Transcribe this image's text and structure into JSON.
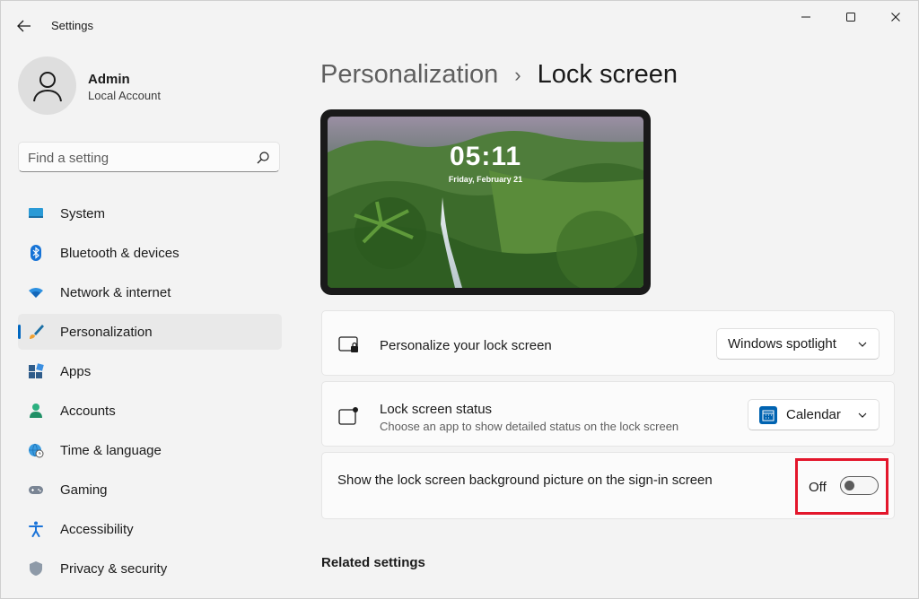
{
  "window": {
    "title": "Settings"
  },
  "user": {
    "name": "Admin",
    "account_type": "Local Account"
  },
  "search": {
    "placeholder": "Find a setting"
  },
  "sidebar": {
    "items": [
      {
        "label": "System",
        "icon": "system-icon",
        "active": false
      },
      {
        "label": "Bluetooth & devices",
        "icon": "bluetooth-icon",
        "active": false
      },
      {
        "label": "Network & internet",
        "icon": "wifi-icon",
        "active": false
      },
      {
        "label": "Personalization",
        "icon": "brush-icon",
        "active": true
      },
      {
        "label": "Apps",
        "icon": "apps-icon",
        "active": false
      },
      {
        "label": "Accounts",
        "icon": "person-icon",
        "active": false
      },
      {
        "label": "Time & language",
        "icon": "globe-clock-icon",
        "active": false
      },
      {
        "label": "Gaming",
        "icon": "gamepad-icon",
        "active": false
      },
      {
        "label": "Accessibility",
        "icon": "accessibility-icon",
        "active": false
      },
      {
        "label": "Privacy & security",
        "icon": "shield-icon",
        "active": false
      }
    ]
  },
  "breadcrumb": {
    "parent": "Personalization",
    "separator": "›",
    "current": "Lock screen"
  },
  "preview": {
    "time": "05:11",
    "date": "Friday, February 21"
  },
  "settings": {
    "personalize": {
      "title": "Personalize your lock screen",
      "value": "Windows spotlight"
    },
    "status": {
      "title": "Lock screen status",
      "description": "Choose an app to show detailed status on the lock screen",
      "value": "Calendar"
    },
    "signin_bg": {
      "title": "Show the lock screen background picture on the sign-in screen",
      "state_label": "Off",
      "enabled": false
    }
  },
  "related": {
    "heading": "Related settings"
  },
  "colors": {
    "accent": "#0067c0",
    "highlight": "#e3162b"
  }
}
